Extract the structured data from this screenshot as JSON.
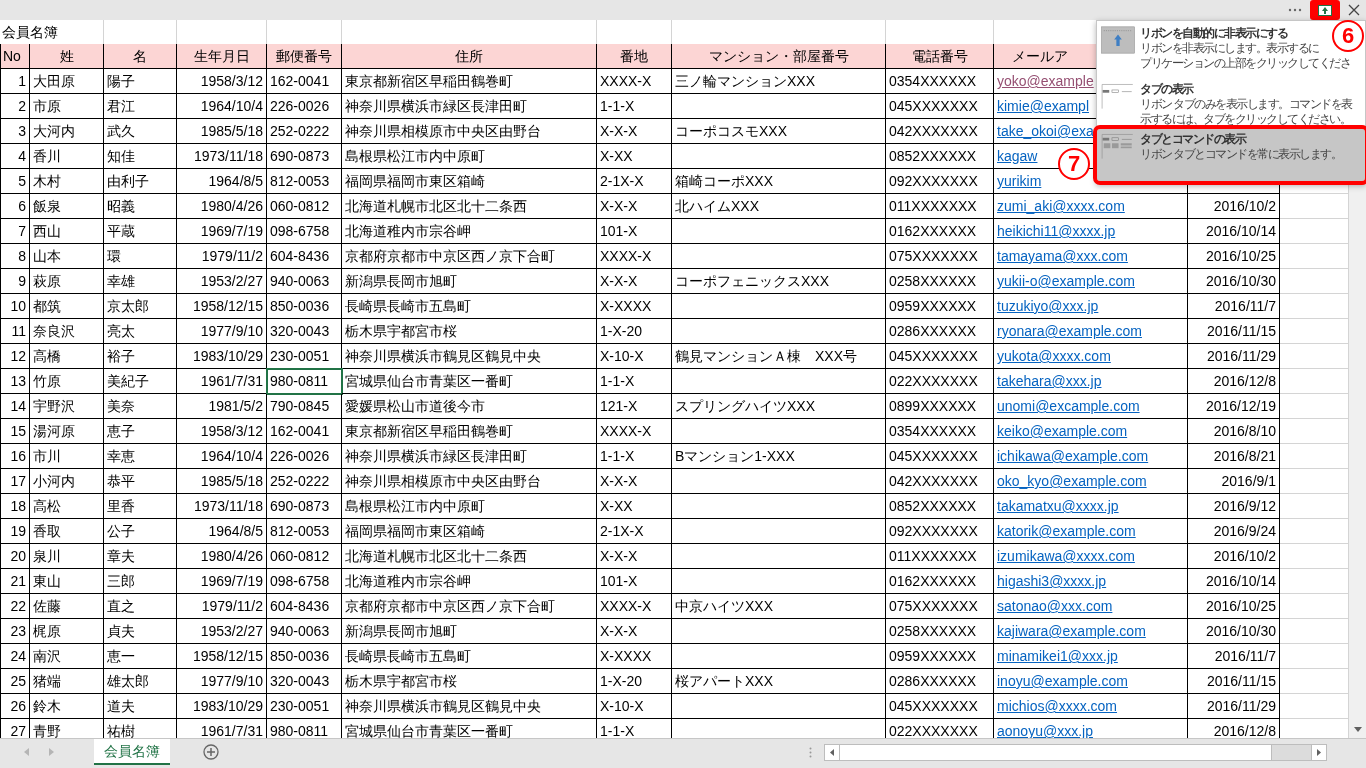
{
  "title_bar": {
    "ribbon_options_button": {
      "highlighted": true
    }
  },
  "sheet": {
    "title": "会員名簿",
    "headers": [
      "No",
      "姓",
      "名",
      "生年月日",
      "郵便番号",
      "住所",
      "番地",
      "マンション・部屋番号",
      "電話番号",
      "メールア"
    ],
    "rows": [
      {
        "no": "1",
        "sei": "大田原",
        "mei": "陽子",
        "birth": "1958/3/12",
        "zip": "162-0041",
        "address": "東京都新宿区早稲田鶴巻町",
        "banchi": "XXXX-X",
        "building": "三ノ輪マンションXXX",
        "phone": "0354XXXXXX",
        "email": "yoko@example",
        "email_visited": true,
        "active": false
      },
      {
        "no": "2",
        "sei": "市原",
        "mei": "君江",
        "birth": "1964/10/4",
        "zip": "226-0026",
        "address": "神奈川県横浜市緑区長津田町",
        "banchi": "1-1-X",
        "phone": "045XXXXXXX",
        "email": "kimie@exampl",
        "email_visited": false,
        "active": false
      },
      {
        "no": "3",
        "sei": "大河内",
        "mei": "武久",
        "birth": "1985/5/18",
        "zip": "252-0222",
        "address": "神奈川県相模原市中央区由野台",
        "banchi": "X-X-X",
        "building": "コーポコスモXXX",
        "phone": "042XXXXXXX",
        "email": "take_okoi@exa",
        "email_visited": false,
        "active": false
      },
      {
        "no": "4",
        "sei": "香川",
        "mei": "知佳",
        "birth": "1973/11/18",
        "zip": "690-0873",
        "address": "島根県松江市内中原町",
        "banchi": "X-XX",
        "phone": "0852XXXXXX",
        "email": "kagaw",
        "email_visited": false,
        "active": false
      },
      {
        "no": "5",
        "sei": "木村",
        "mei": "由利子",
        "birth": "1964/8/5",
        "zip": "812-0053",
        "address": "福岡県福岡市東区箱崎",
        "banchi": "2-1X-X",
        "building": "箱崎コーポXXX",
        "phone": "092XXXXXXX",
        "email": "yurikim",
        "email_visited": false,
        "active": false
      },
      {
        "no": "6",
        "sei": "飯泉",
        "mei": "昭義",
        "birth": "1980/4/26",
        "zip": "060-0812",
        "address": "北海道札幌市北区北十二条西",
        "banchi": "X-X-X",
        "building": "北ハイムXXX",
        "phone": "011XXXXXXX",
        "email": "zumi_aki@xxxx.com",
        "date": "2016/10/2",
        "email_visited": false,
        "active": false
      },
      {
        "no": "7",
        "sei": "西山",
        "mei": "平蔵",
        "birth": "1969/7/19",
        "zip": "098-6758",
        "address": "北海道稚内市宗谷岬",
        "banchi": "101-X",
        "phone": "0162XXXXXX",
        "email": "heikichi11@xxxx.jp",
        "date": "2016/10/14",
        "email_visited": false,
        "active": false
      },
      {
        "no": "8",
        "sei": "山本",
        "mei": "環",
        "birth": "1979/11/2",
        "zip": "604-8436",
        "address": "京都府京都市中京区西ノ京下合町",
        "banchi": "XXXX-X",
        "phone": "075XXXXXXX",
        "email": "tamayama@xxx.com",
        "date": "2016/10/25",
        "email_visited": false,
        "active": false
      },
      {
        "no": "9",
        "sei": "萩原",
        "mei": "幸雄",
        "birth": "1953/2/27",
        "zip": "940-0063",
        "address": "新潟県長岡市旭町",
        "banchi": "X-X-X",
        "building": "コーポフェニックスXXX",
        "phone": "0258XXXXXX",
        "email": "yukii-o@example.com",
        "date": "2016/10/30",
        "email_visited": false,
        "active": false
      },
      {
        "no": "10",
        "sei": "都筑",
        "mei": "京太郎",
        "birth": "1958/12/15",
        "zip": "850-0036",
        "address": "長崎県長崎市五島町",
        "banchi": "X-XXXX",
        "phone": "0959XXXXXX",
        "email": "tuzukiyo@xxx.jp",
        "date": "2016/11/7",
        "email_visited": false,
        "active": false
      },
      {
        "no": "11",
        "sei": "奈良沢",
        "mei": "亮太",
        "birth": "1977/9/10",
        "zip": "320-0043",
        "address": "栃木県宇都宮市桜",
        "banchi": "1-X-20",
        "phone": "0286XXXXXX",
        "email": "ryonara@example.com",
        "date": "2016/11/15",
        "email_visited": false,
        "active": false
      },
      {
        "no": "12",
        "sei": "高橋",
        "mei": "裕子",
        "birth": "1983/10/29",
        "zip": "230-0051",
        "address": "神奈川県横浜市鶴見区鶴見中央",
        "banchi": "X-10-X",
        "building": "鶴見マンションＡ棟　XXX号",
        "phone": "045XXXXXXX",
        "email": "yukota@xxxx.com",
        "date": "2016/11/29",
        "email_visited": false,
        "active": false
      },
      {
        "no": "13",
        "sei": "竹原",
        "mei": "美紀子",
        "birth": "1961/7/31",
        "zip": "980-0811",
        "address": "宮城県仙台市青葉区一番町",
        "banchi": "1-1-X",
        "phone": "022XXXXXXX",
        "email": "takehara@xxx.jp",
        "date": "2016/12/8",
        "email_visited": false,
        "active": true
      },
      {
        "no": "14",
        "sei": "宇野沢",
        "mei": "美奈",
        "birth": "1981/5/2",
        "zip": "790-0845",
        "address": "愛媛県松山市道後今市",
        "banchi": "121-X",
        "building": "スプリングハイツXXX",
        "phone": "0899XXXXXX",
        "email": "unomi@excample.com",
        "date": "2016/12/19",
        "email_visited": false,
        "active": false
      },
      {
        "no": "15",
        "sei": "湯河原",
        "mei": "恵子",
        "birth": "1958/3/12",
        "zip": "162-0041",
        "address": "東京都新宿区早稲田鶴巻町",
        "banchi": "XXXX-X",
        "phone": "0354XXXXXX",
        "email": "keiko@example.com",
        "date": "2016/8/10",
        "email_visited": false,
        "active": false
      },
      {
        "no": "16",
        "sei": "市川",
        "mei": "幸恵",
        "birth": "1964/10/4",
        "zip": "226-0026",
        "address": "神奈川県横浜市緑区長津田町",
        "banchi": "1-1-X",
        "building": "Bマンション1-XXX",
        "phone": "045XXXXXXX",
        "email": "ichikawa@example.com",
        "date": "2016/8/21",
        "email_visited": false,
        "active": false
      },
      {
        "no": "17",
        "sei": "小河内",
        "mei": "恭平",
        "birth": "1985/5/18",
        "zip": "252-0222",
        "address": "神奈川県相模原市中央区由野台",
        "banchi": "X-X-X",
        "phone": "042XXXXXXX",
        "email": "oko_kyo@example.com",
        "date": "2016/9/1",
        "email_visited": false,
        "active": false
      },
      {
        "no": "18",
        "sei": "高松",
        "mei": "里香",
        "birth": "1973/11/18",
        "zip": "690-0873",
        "address": "島根県松江市内中原町",
        "banchi": "X-XX",
        "phone": "0852XXXXXX",
        "email": "takamatxu@xxxx.jp",
        "date": "2016/9/12",
        "email_visited": false,
        "active": false
      },
      {
        "no": "19",
        "sei": "香取",
        "mei": "公子",
        "birth": "1964/8/5",
        "zip": "812-0053",
        "address": "福岡県福岡市東区箱崎",
        "banchi": "2-1X-X",
        "phone": "092XXXXXXX",
        "email": "katorik@example.com",
        "date": "2016/9/24",
        "email_visited": false,
        "active": false
      },
      {
        "no": "20",
        "sei": "泉川",
        "mei": "章夫",
        "birth": "1980/4/26",
        "zip": "060-0812",
        "address": "北海道札幌市北区北十二条西",
        "banchi": "X-X-X",
        "phone": "011XXXXXXX",
        "email": "izumikawa@xxxx.com",
        "date": "2016/10/2",
        "email_visited": false,
        "active": false
      },
      {
        "no": "21",
        "sei": "東山",
        "mei": "三郎",
        "birth": "1969/7/19",
        "zip": "098-6758",
        "address": "北海道稚内市宗谷岬",
        "banchi": "101-X",
        "phone": "0162XXXXXX",
        "email": "higashi3@xxxx.jp",
        "date": "2016/10/14",
        "email_visited": false,
        "active": false
      },
      {
        "no": "22",
        "sei": "佐藤",
        "mei": "直之",
        "birth": "1979/11/2",
        "zip": "604-8436",
        "address": "京都府京都市中京区西ノ京下合町",
        "banchi": "XXXX-X",
        "building": "中京ハイツXXX",
        "phone": "075XXXXXXX",
        "email": "satonao@xxx.com",
        "date": "2016/10/25",
        "email_visited": false,
        "active": false
      },
      {
        "no": "23",
        "sei": "梶原",
        "mei": "貞夫",
        "birth": "1953/2/27",
        "zip": "940-0063",
        "address": "新潟県長岡市旭町",
        "banchi": "X-X-X",
        "phone": "0258XXXXXX",
        "email": "kajiwara@example.com",
        "date": "2016/10/30",
        "email_visited": false,
        "active": false
      },
      {
        "no": "24",
        "sei": "南沢",
        "mei": "恵一",
        "birth": "1958/12/15",
        "zip": "850-0036",
        "address": "長崎県長崎市五島町",
        "banchi": "X-XXXX",
        "phone": "0959XXXXXX",
        "email": "minamikei1@xxx.jp",
        "date": "2016/11/7",
        "email_visited": false,
        "active": false
      },
      {
        "no": "25",
        "sei": "猪端",
        "mei": "雄太郎",
        "birth": "1977/9/10",
        "zip": "320-0043",
        "address": "栃木県宇都宮市桜",
        "banchi": "1-X-20",
        "building": "桜アパートXXX",
        "phone": "0286XXXXXX",
        "email": "inoyu@example.com",
        "date": "2016/11/15",
        "email_visited": false,
        "active": false
      },
      {
        "no": "26",
        "sei": "鈴木",
        "mei": "道夫",
        "birth": "1983/10/29",
        "zip": "230-0051",
        "address": "神奈川県横浜市鶴見区鶴見中央",
        "banchi": "X-10-X",
        "phone": "045XXXXXXX",
        "email": "michios@xxxx.com",
        "date": "2016/11/29",
        "email_visited": false,
        "active": false
      },
      {
        "no": "27",
        "sei": "青野",
        "mei": "祐樹",
        "birth": "1961/7/31",
        "zip": "980-0811",
        "address": "宮城県仙台市青葉区一番町",
        "banchi": "1-1-X",
        "phone": "022XXXXXXX",
        "email": "aonoyu@xxx.jp",
        "date": "2016/12/8",
        "email_visited": false,
        "active": false
      }
    ]
  },
  "sheet_tabs": [
    {
      "label": "会員名簿",
      "selected": true
    }
  ],
  "ribbon_display_menu": {
    "items": [
      {
        "title": "リボンを自動的に非表示にする",
        "description_lines": [
          "リボンを非表示にします。表示するに",
          "プリケーションの上部をクリックしてくださ"
        ],
        "selected": false,
        "highlighted": false
      },
      {
        "title": "タブの表示",
        "description_lines": [
          "リボン タブのみを表示します。コマンドを表",
          "示するには、タブをクリックしてください。"
        ],
        "selected": false,
        "highlighted": false
      },
      {
        "title": "タブとコマンドの表示",
        "description_lines": [
          "リボン タブとコマンドを常に表示します。"
        ],
        "selected": true,
        "highlighted": true
      }
    ]
  },
  "callouts": [
    {
      "label": "6"
    },
    {
      "label": "7"
    }
  ]
}
